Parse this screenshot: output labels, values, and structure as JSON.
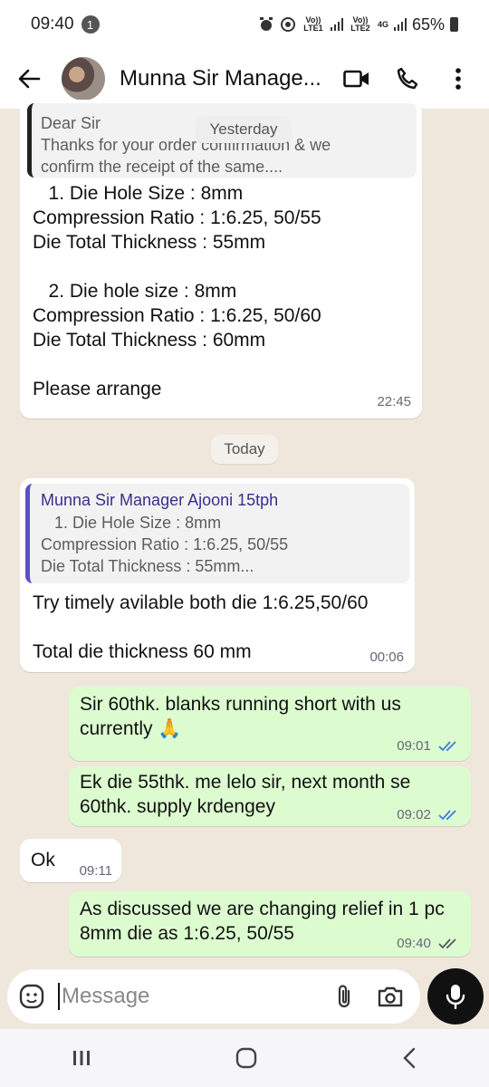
{
  "status": {
    "time": "09:40",
    "notification_count": "1",
    "battery": "65%",
    "sim1": "Vo)) LTE1",
    "sim2": "Vo)) LTE2",
    "network": "4G"
  },
  "header": {
    "contact_name": "Munna Sir Manage...",
    "icons": [
      "back-arrow-icon",
      "video-call-icon",
      "phone-icon",
      "more-vert-icon"
    ]
  },
  "messages": {
    "m1": {
      "quote_text": "Dear Sir\nThanks for your order confirmation & we\nconfirm the receipt of the same....",
      "text": "   1. Die Hole Size : 8mm\nCompression Ratio : 1:6.25, 50/55\nDie Total Thickness : 55mm\n\n   2. Die hole size : 8mm\nCompression Ratio : 1:6.25, 50/60\nDie Total Thickness : 60mm\n\nPlease arrange",
      "time": "22:45"
    },
    "date_yesterday": "Yesterday",
    "date_today": "Today",
    "m2": {
      "quote_name": "Munna Sir Manager Ajooni 15tph",
      "quote_text": "   1. Die Hole Size : 8mm\nCompression Ratio : 1:6.25, 50/55\nDie Total Thickness : 55mm...",
      "text": "Try timely avilable both die 1:6.25,50/60\n\nTotal die thickness 60 mm",
      "time": "00:06"
    },
    "m3": {
      "text": "Sir 60thk. blanks running short with us currently 🙏",
      "time": "09:01",
      "status": "read"
    },
    "m4": {
      "text": "Ek die 55thk. me lelo sir, next month se 60thk. supply krdengey",
      "time": "09:02",
      "status": "read"
    },
    "m5": {
      "text": "Ok",
      "time": "09:11"
    },
    "m6": {
      "text": "As discussed we are changing relief in 1 pc 8mm die as 1:6.25, 50/55",
      "time": "09:40",
      "status": "delivered"
    }
  },
  "input": {
    "placeholder": "Message",
    "icons": [
      "sticker-icon",
      "attach-icon",
      "camera-icon",
      "mic-icon"
    ]
  },
  "nav": {
    "icons": [
      "recents-icon",
      "home-icon",
      "back-icon"
    ]
  },
  "colors": {
    "chat_bg": "#efe7dc",
    "outgoing_bubble": "#dcfcd0",
    "incoming_bubble": "#ffffff",
    "read_tick": "#3b7ae0",
    "quote_bar": "#5b4fc7"
  }
}
